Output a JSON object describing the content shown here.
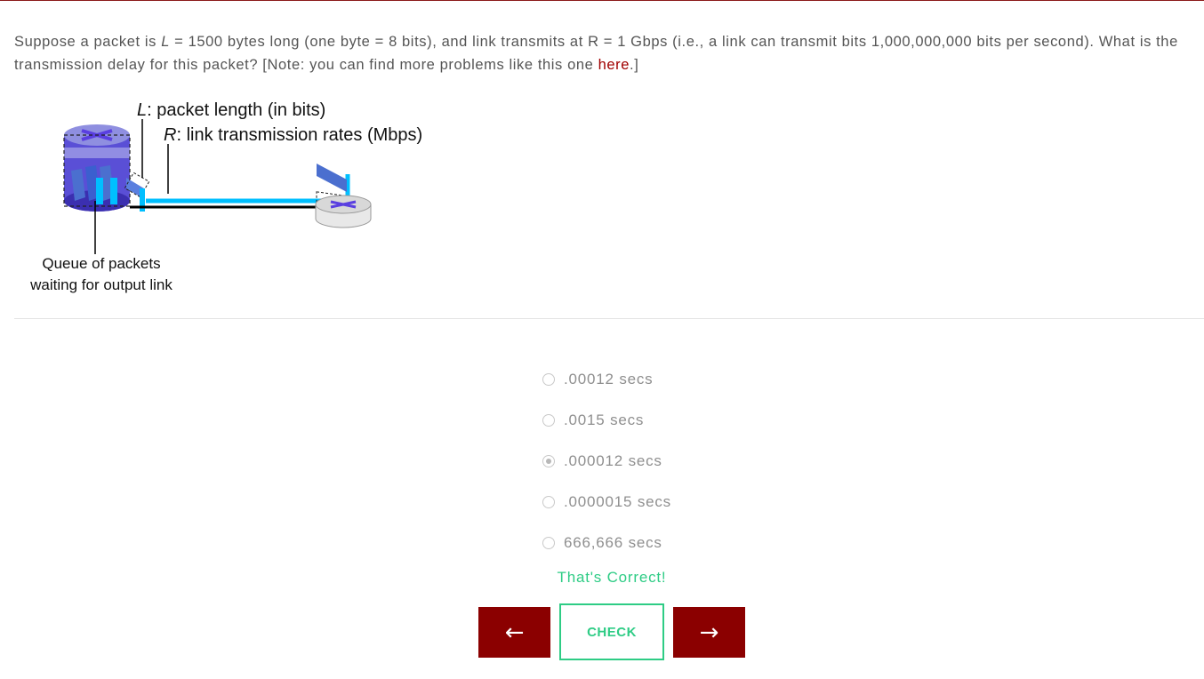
{
  "question": {
    "prefix": "Suppose a packet is ",
    "var_l": "L",
    "middle": " = 1500 bytes long (one byte = 8 bits), and link transmits at R = 1 Gbps (i.e., a link can transmit bits 1,000,000,000 bits per second).  What is the transmission delay for this packet? [Note: you can find more problems like this one ",
    "link_text": "here",
    "suffix": ".]"
  },
  "diagram": {
    "l_var": "L",
    "l_label": ": packet length (in bits)",
    "r_var": "R",
    "r_label": ": link transmission rates (Mbps)",
    "queue_line1": "Queue of packets",
    "queue_line2": "waiting for output link"
  },
  "options": [
    {
      "label": ".00012 secs",
      "selected": false
    },
    {
      "label": ".0015 secs",
      "selected": false
    },
    {
      "label": ".000012 secs",
      "selected": true
    },
    {
      "label": ".0000015 secs",
      "selected": false
    },
    {
      "label": "666,666 secs",
      "selected": false
    }
  ],
  "feedback": "That's Correct!",
  "buttons": {
    "prev": "←",
    "check": "CHECK",
    "next": "→"
  },
  "colors": {
    "accent": "#8b0000",
    "success": "#2ecc85",
    "link": "#00bfff",
    "router": "#4b3ccc"
  }
}
